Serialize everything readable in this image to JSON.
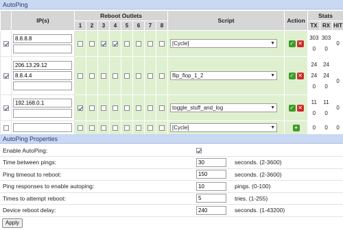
{
  "autoping": {
    "title": "AutoPing",
    "headers": {
      "ips": "IP(s)",
      "outlets": "Reboot Outlets",
      "script": "Script",
      "action": "Action",
      "stats": "Stats",
      "tx": "TX",
      "rx": "RX",
      "hit": "HIT"
    },
    "outlet_numbers": [
      "1",
      "2",
      "3",
      "4",
      "5",
      "6",
      "7",
      "8"
    ],
    "rows": [
      {
        "enabled": true,
        "ip1": "8.8.8.8",
        "ip2": "",
        "outlets": [
          false,
          false,
          true,
          true,
          false,
          false,
          false,
          false
        ],
        "script": "[Cycle]",
        "stats_top": [
          "303",
          "303",
          "0"
        ],
        "stats_bottom": [
          "0",
          "0"
        ]
      },
      {
        "enabled": true,
        "ip1": "206.13.29.12",
        "ip2": "8.8.4.4",
        "ip3": "",
        "outlets": [
          false,
          false,
          false,
          false,
          false,
          false,
          false,
          false
        ],
        "script": "flip_flop_1_2",
        "stats_top": [
          "24",
          "24"
        ],
        "stats_mid": [
          "24",
          "24",
          "0"
        ],
        "stats_bottom": [
          "0",
          "0"
        ]
      },
      {
        "enabled": true,
        "ip1": "192.168.0.1",
        "ip2": "",
        "outlets": [
          true,
          false,
          false,
          false,
          false,
          false,
          false,
          false
        ],
        "script": "toggle_stuff_and_log",
        "stats_top": [
          "11",
          "11",
          "0"
        ],
        "stats_bottom": [
          "0",
          "0"
        ]
      },
      {
        "enabled": false,
        "ip1": "",
        "outlets": [
          false,
          false,
          false,
          false,
          false,
          false,
          false,
          false
        ],
        "script": "[Cycle]",
        "stats_top": [
          "0",
          "0",
          "0"
        ]
      }
    ]
  },
  "properties": {
    "title": "AutoPing Properties",
    "enable_label": "Enable AutoPing:",
    "enable_checked": true,
    "items": [
      {
        "label": "Time between pings:",
        "value": "30",
        "hint": "seconds. (2-3600)"
      },
      {
        "label": "Ping timeout to reboot:",
        "value": "150",
        "hint": "seconds. (2-3600)"
      },
      {
        "label": "Ping responses to enable autoping:",
        "value": "10",
        "hint": "pings. (0-100)"
      },
      {
        "label": "Times to attempt reboot:",
        "value": "5",
        "hint": "tries. (1-255)"
      },
      {
        "label": "Device reboot delay:",
        "value": "240",
        "hint": "seconds. (1-43200)"
      }
    ],
    "apply_label": "Apply"
  }
}
